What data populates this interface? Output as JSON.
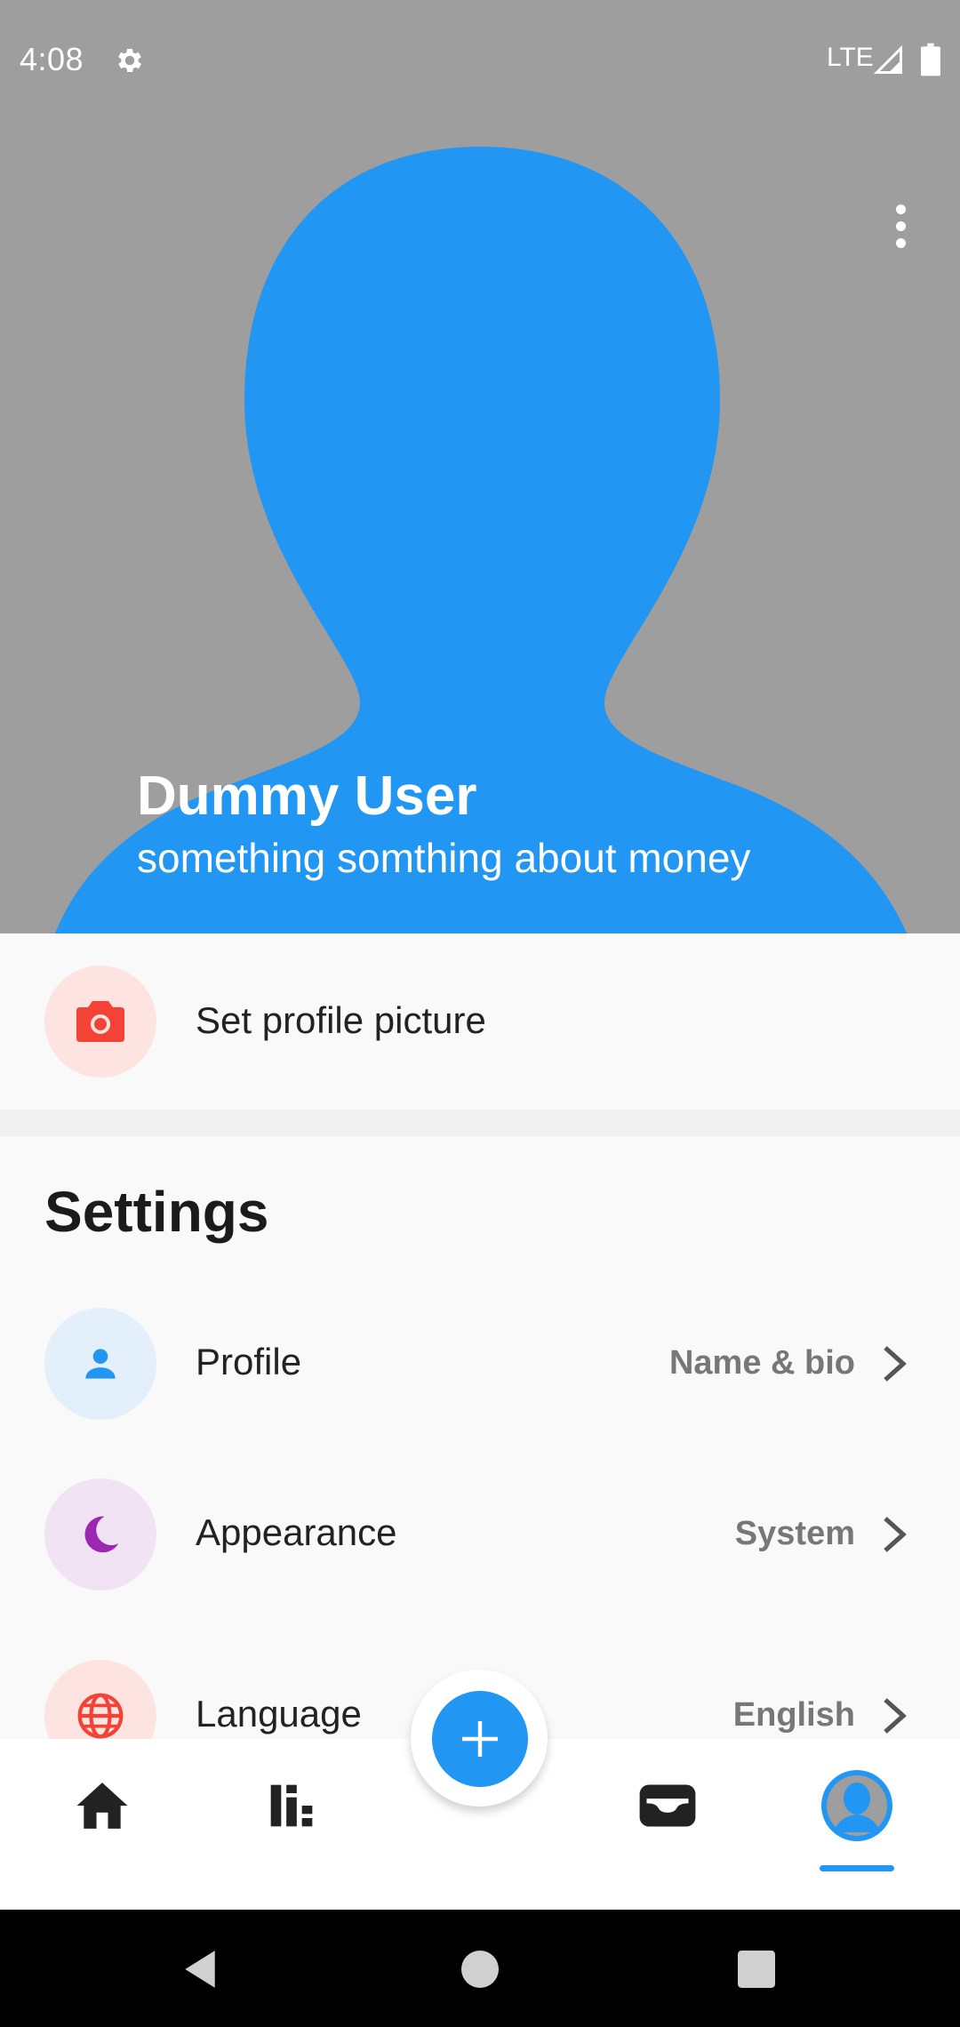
{
  "status_bar": {
    "time": "4:08",
    "network": "LTE",
    "icons": [
      "gear-icon",
      "signal-icon",
      "battery-icon"
    ]
  },
  "header": {
    "user_name": "Dummy User",
    "user_bio": "something somthing about money",
    "menu_icon": "more-vert-icon"
  },
  "profile_picture": {
    "label": "Set profile picture",
    "icon": "camera-icon"
  },
  "settings": {
    "title": "Settings",
    "items": [
      {
        "label": "Profile",
        "value": "Name & bio",
        "icon": "person-icon"
      },
      {
        "label": "Appearance",
        "value": "System",
        "icon": "moon-icon"
      },
      {
        "label": "Language",
        "value": "English",
        "icon": "globe-icon"
      }
    ]
  },
  "bottom_nav": {
    "items": [
      "home-icon",
      "stats-icon",
      "add-icon",
      "wallet-icon",
      "profile-icon"
    ],
    "active": "profile-icon"
  },
  "colors": {
    "primary": "#2196f3",
    "silhouette": "#9e9e9e",
    "camera_red": "#f44336",
    "camera_bg": "#fde4e1",
    "profile_bg": "#e3f0fc",
    "appearance_purple": "#9c27b0",
    "appearance_bg": "#f1e3f4",
    "language_bg": "#fde4e1"
  }
}
